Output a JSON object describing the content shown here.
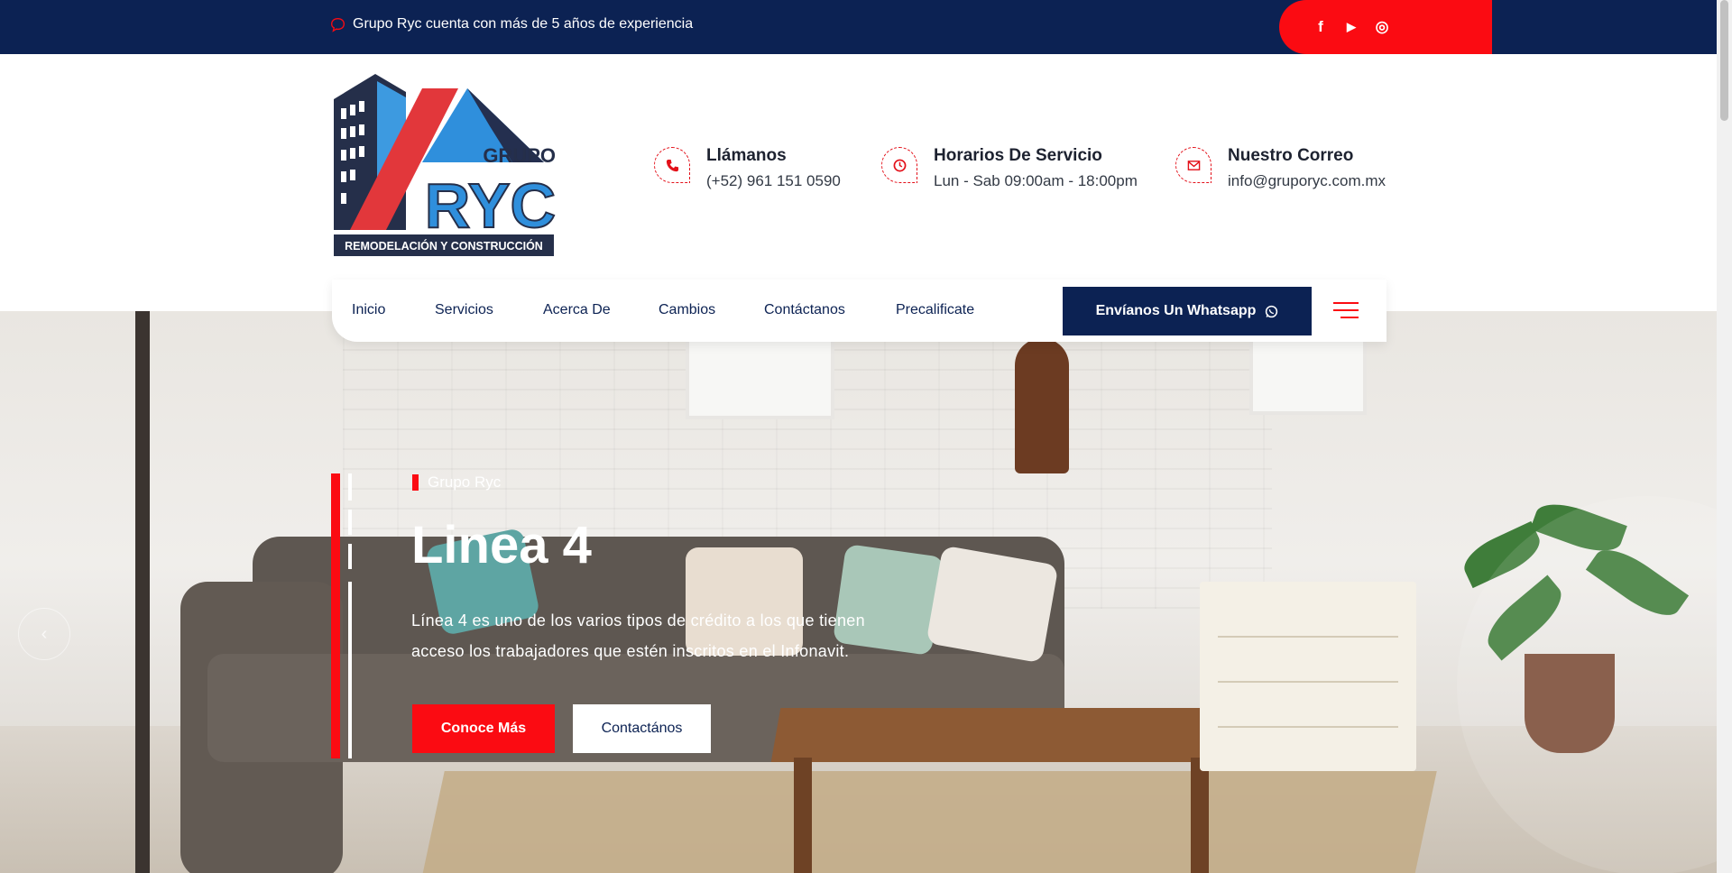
{
  "topbar": {
    "message": "Grupo Ryc cuenta con más de 5 años de experiencia",
    "social": [
      {
        "icon": "facebook-icon",
        "glyph": "f"
      },
      {
        "icon": "youtube-icon",
        "glyph": "▶"
      },
      {
        "icon": "instagram-icon",
        "glyph": "◎"
      }
    ]
  },
  "logo": {
    "word1": "GRUPO",
    "word2": "RYC",
    "tagline": "REMODELACIÓN Y CONSTRUCCIÓN"
  },
  "contact": {
    "phone": {
      "title": "Llámanos",
      "value": "(+52) 961 151 0590"
    },
    "hours": {
      "title": "Horarios De Servicio",
      "value": "Lun - Sab 09:00am - 18:00pm"
    },
    "email": {
      "title": "Nuestro Correo",
      "value": "info@gruporyc.com.mx"
    }
  },
  "nav": {
    "items": [
      "Inicio",
      "Servicios",
      "Acerca De",
      "Cambios",
      "Contáctanos",
      "Precalificate"
    ],
    "whatsapp_label": "Envíanos Un Whatsapp"
  },
  "hero": {
    "kicker": "Grupo Ryc",
    "title": "Linea 4",
    "description": "Línea 4 es uno de los varios tipos de crédito a los que tienen acceso los trabajadores que estén inscritos en el Infonavit.",
    "primary_button": "Conoce Más",
    "secondary_button": "Contactános",
    "prev_arrow": "‹"
  },
  "colors": {
    "navy": "#0c2253",
    "red": "#fb0b12"
  }
}
